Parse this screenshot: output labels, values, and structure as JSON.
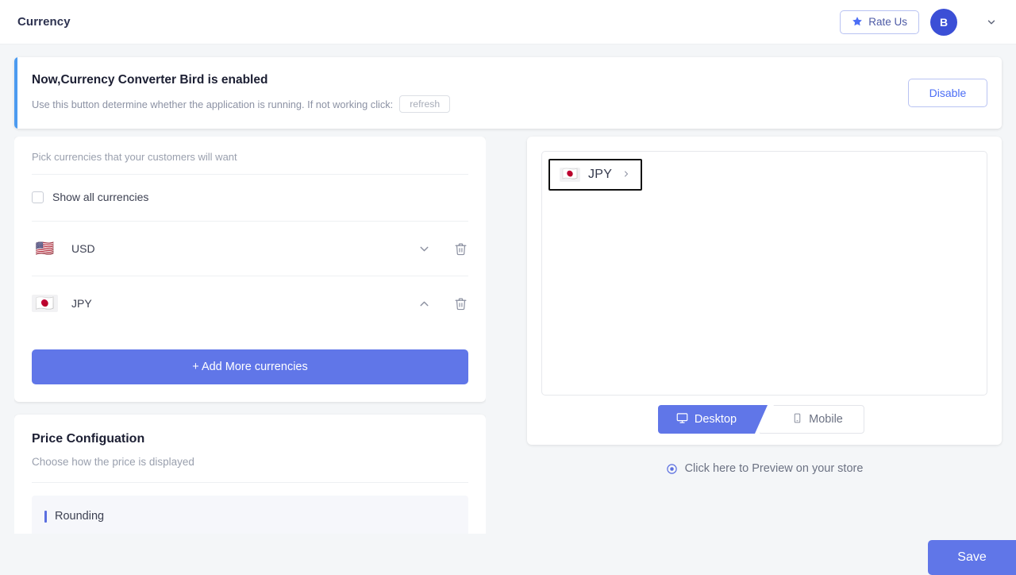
{
  "topbar": {
    "title": "Currency",
    "rate_us_label": "Rate Us",
    "star_icon": "star-icon",
    "avatar_initial": "B",
    "chevron_icon": "chevron-down-icon"
  },
  "banner": {
    "title": "Now,Currency Converter Bird is enabled",
    "description": "Use this button determine whether the application is running.  If not working click:",
    "refresh_label": "refresh",
    "disable_label": "Disable",
    "accent_color": "#4c9bf0"
  },
  "currencies_card": {
    "hint": "Pick currencies that your customers will want",
    "show_all_label": "Show all currencies",
    "show_all_checked": false,
    "rows": [
      {
        "flag": "🇺🇸",
        "code": "USD",
        "toggle_icon": "chevron-down-icon",
        "delete_icon": "trash-icon"
      },
      {
        "flag": "🇯🇵",
        "code": "JPY",
        "toggle_icon": "chevron-up-icon",
        "delete_icon": "trash-icon"
      }
    ],
    "add_label": "+ Add More currencies"
  },
  "price_config": {
    "title": "Price Configuation",
    "subtitle": "Choose how the price is displayed",
    "rounding_label": "Rounding"
  },
  "preview": {
    "chip": {
      "flag": "🇯🇵",
      "code": "JPY",
      "arrow_icon": "chevron-right-icon"
    },
    "tabs": [
      {
        "label": "Desktop",
        "icon": "monitor-icon",
        "active": true
      },
      {
        "label": "Mobile",
        "icon": "phone-icon",
        "active": false
      }
    ],
    "link_label": "Click here to Preview on your store",
    "link_icon": "eye-icon"
  },
  "footer": {
    "save_label": "Save"
  },
  "colors": {
    "accent": "#6076e8",
    "banner_accent": "#4c9bf0",
    "page_bg": "#f4f6f8"
  }
}
